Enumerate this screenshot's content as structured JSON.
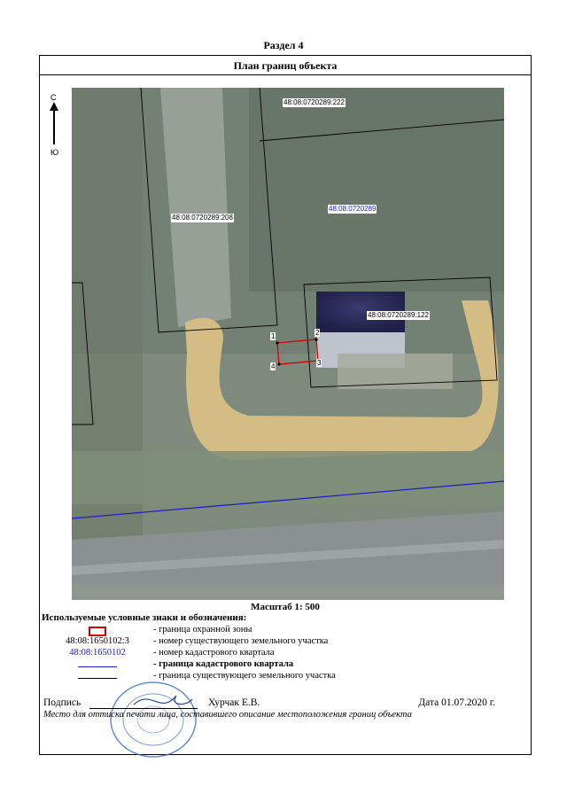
{
  "section": "Раздел 4",
  "header": "План границ объекта",
  "compass": {
    "north": "С",
    "south": "Ю"
  },
  "map_labels": {
    "parcel_222": "48:08:0720289:222",
    "parcel_208": "48:08:0720289:208",
    "quarter": "48:08:0720289",
    "parcel_122": "48:08:0720289:122",
    "points": [
      "1",
      "2",
      "3",
      "4"
    ]
  },
  "scale": "Масштаб 1: 500",
  "legend": {
    "title": "Используемые условные знаки и обозначения:",
    "items": [
      {
        "symbol": "",
        "desc": "- граница  охранной зоны"
      },
      {
        "symbol": "48:08:1650102:3",
        "desc": "- номер существующего земельного участка"
      },
      {
        "symbol": "48:08:1650102",
        "desc": "- номер кадастрового квартала"
      },
      {
        "symbol": "",
        "desc": "- граница кадастрового квартала"
      },
      {
        "symbol": "",
        "desc": "- граница существующего земельного участка"
      }
    ]
  },
  "signature": {
    "label": "Подпись",
    "name": "Хурчак Е.В.",
    "date": "Дата 01.07.2020 г.",
    "stamp_note": "Место для оттиска печати лица, составившего описание местоположения границ объекта"
  },
  "colors": {
    "red": "#d40000",
    "blue": "#1a1acc",
    "map_bg": "#7f8a7d"
  },
  "icons": [
    "north-arrow-icon",
    "stamp-seal"
  ]
}
